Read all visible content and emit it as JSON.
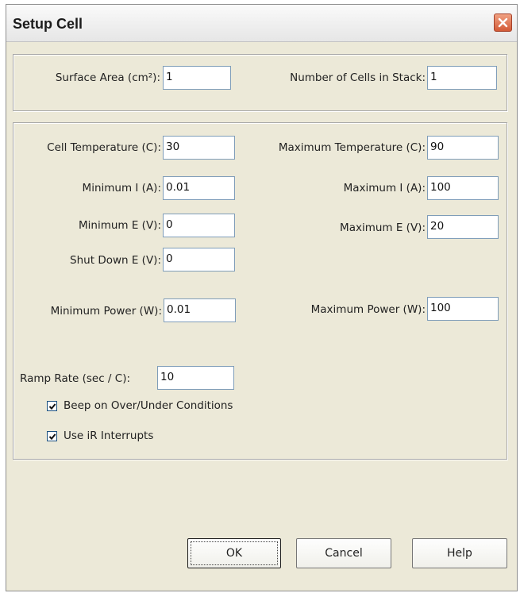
{
  "window": {
    "title": "Setup Cell"
  },
  "top": {
    "surface_area": {
      "label": "Surface Area (cm²):",
      "value": "1"
    },
    "num_cells": {
      "label": "Number of Cells in Stack:",
      "value": "1"
    }
  },
  "params": {
    "cell_temperature": {
      "label": "Cell Temperature (C):",
      "value": "30"
    },
    "max_temperature": {
      "label": "Maximum Temperature (C):",
      "value": "90"
    },
    "min_current": {
      "label": "Minimum I (A):",
      "value": "0.01"
    },
    "max_current": {
      "label": "Maximum I (A):",
      "value": "100"
    },
    "min_voltage": {
      "label": "Minimum E (V):",
      "value": "0"
    },
    "max_voltage": {
      "label": "Maximum E (V):",
      "value": "20"
    },
    "shutdown_voltage": {
      "label": "Shut Down E (V):",
      "value": "0"
    },
    "min_power": {
      "label": "Minimum Power (W):",
      "value": "0.01"
    },
    "max_power": {
      "label": "Maximum Power (W):",
      "value": "100"
    },
    "ramp_rate": {
      "label": "Ramp Rate (sec / C):",
      "value": "10"
    }
  },
  "checkboxes": {
    "beep": {
      "label": "Beep on Over/Under Conditions",
      "checked": true
    },
    "ir": {
      "label": "Use iR Interrupts",
      "checked": true
    }
  },
  "buttons": {
    "ok": "OK",
    "cancel": "Cancel",
    "help": "Help"
  },
  "icons": {
    "close": "close-icon",
    "check": "checkmark-icon"
  }
}
